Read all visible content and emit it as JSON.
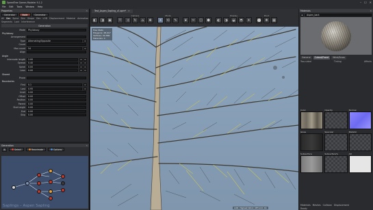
{
  "window": {
    "title": "SpeedTree Games Modeler 9.1.2",
    "controls": [
      "–",
      "☐",
      "✕"
    ]
  },
  "menu": [
    "File",
    "Edit",
    "Tools",
    "Window",
    "Help"
  ],
  "properties": {
    "panel_title": "Properties",
    "generator_tabs": [
      "Generator",
      "Node",
      "Generator"
    ],
    "node_tabs": [
      "All",
      "Gen",
      "Spine",
      "Skin",
      "Shape",
      "Dim",
      "LOD",
      "Displacement",
      "Material",
      "Animation"
    ],
    "sub_tabs": [
      "Segments",
      "Lock",
      "Interference"
    ],
    "section_title": "Generation",
    "mode_label": "Mode",
    "mode_value": "Phyllotaxy",
    "groups": [
      {
        "name": "Phyllotaxy",
        "rows": [
          {
            "label": "Arrangement",
            "value": ""
          },
          {
            "label": "Type",
            "value": "Alternating/Opposite"
          },
          {
            "label": "Count",
            "value": ""
          },
          {
            "label": "Max count",
            "value": "54"
          },
          {
            "label": "Align",
            "value": ""
          }
        ]
      },
      {
        "name": "Angle",
        "rows": [
          {
            "label": "Internode length",
            "value": "2.00"
          },
          {
            "label": "Spread",
            "value": "0.40"
          },
          {
            "label": "Spiral",
            "value": "0.00"
          },
          {
            "label": "Lean",
            "value": "0.00"
          }
        ]
      },
      {
        "name": "Shared",
        "rows": [
          {
            "label": "Prune",
            "value": ""
          }
        ]
      },
      {
        "name": "Boundaries",
        "rows": [
          {
            "label": "First",
            "value": "0.1"
          },
          {
            "label": "Last",
            "value": "0.95"
          },
          {
            "label": "Inset",
            "value": "0.00"
          },
          {
            "label": "Offset",
            "value": "0.00"
          },
          {
            "label": "Position",
            "value": "0.00"
          },
          {
            "label": "Parent",
            "value": "0.00"
          },
          {
            "label": "Start angle",
            "value": "0.00"
          },
          {
            "label": "End",
            "value": "0.00"
          },
          {
            "label": "Skip",
            "value": "0.00"
          }
        ]
      }
    ]
  },
  "generation_editor": {
    "title": "Generation",
    "buttons": [
      {
        "label": "Select",
        "color": "#e0443a"
      },
      {
        "label": "Reanimate",
        "color": "#e07d2a"
      },
      {
        "label": "Options",
        "color": "#4b8fd6"
      }
    ],
    "watermark": "Saplings – Aspen Sapling"
  },
  "viewport": {
    "tabs": [
      {
        "label": "Test_Aspen_Sapling_v1.spm*",
        "close": "✕"
      }
    ],
    "toolbar_groups": [
      {
        "name": "",
        "buttons": [
          "◧",
          "◨",
          "▣"
        ]
      },
      {
        "name": "Camera",
        "buttons": [
          "⤧",
          "⤨",
          "↻",
          "⌂",
          "✥"
        ]
      },
      {
        "name": "Mode",
        "buttons": [
          "✦",
          "⟲",
          "✎"
        ]
      },
      {
        "name": "",
        "buttons": [
          "❦",
          "✂",
          "⬡",
          "⬢"
        ]
      },
      {
        "name": "Display",
        "buttons": [
          "◐",
          "◑",
          "◒",
          "◓",
          "☀"
        ]
      },
      {
        "name": "Pivot",
        "buttons": [
          "⬤",
          "❖",
          "▦"
        ]
      }
    ],
    "stats": [
      "Tree Stats",
      "Polygons: 28,417",
      "Vertices: 32,560",
      "Materials: 4"
    ],
    "status_text": "LOD: Highest   Wind: Off   Grid: On"
  },
  "material": {
    "panel_title": "Materials",
    "material_name": "Aspen_bark",
    "tabs": [
      "General",
      "Cutout/Frond",
      "Wind/Snow"
    ],
    "options": [
      "Two-sided",
      "Tinting",
      "Affects"
    ],
    "maps": [
      {
        "label": "Color",
        "style": "bark"
      },
      {
        "label": "Opacity",
        "style": "checker"
      },
      {
        "label": "Normal",
        "style": "normal"
      },
      {
        "label": "Gloss",
        "style": "dark"
      },
      {
        "label": "Specular",
        "style": "checker"
      },
      {
        "label": "Metallic",
        "style": "checker"
      },
      {
        "label": "Subsurface",
        "style": "gray"
      },
      {
        "label": "Subsurface%",
        "style": "checker"
      },
      {
        "label": "AO",
        "style": "white"
      }
    ],
    "bottom_tabs": [
      "Materials",
      "Meshes",
      "Collision",
      "Displacement"
    ],
    "status": "Ready"
  }
}
